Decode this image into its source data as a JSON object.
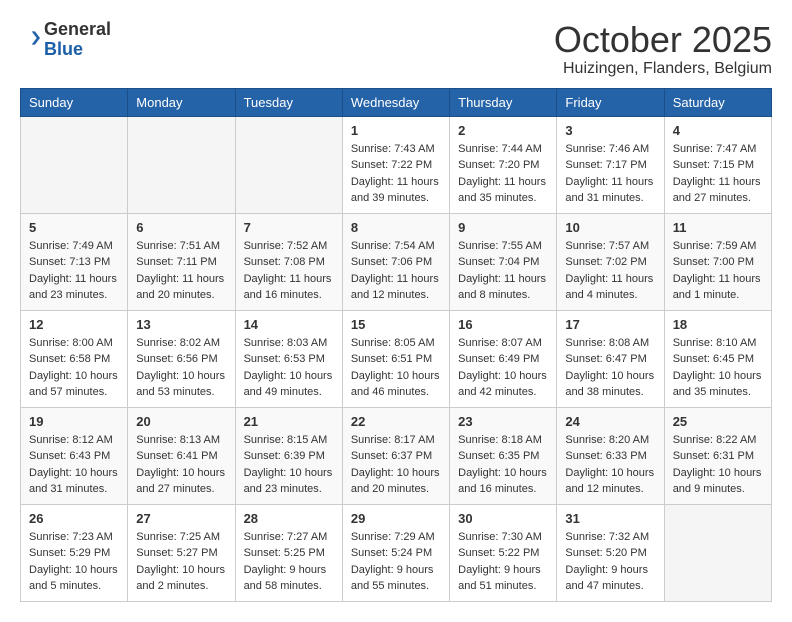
{
  "header": {
    "logo_general": "General",
    "logo_blue": "Blue",
    "month": "October 2025",
    "location": "Huizingen, Flanders, Belgium"
  },
  "weekdays": [
    "Sunday",
    "Monday",
    "Tuesday",
    "Wednesday",
    "Thursday",
    "Friday",
    "Saturday"
  ],
  "weeks": [
    [
      {
        "day": "",
        "info": ""
      },
      {
        "day": "",
        "info": ""
      },
      {
        "day": "",
        "info": ""
      },
      {
        "day": "1",
        "info": "Sunrise: 7:43 AM\nSunset: 7:22 PM\nDaylight: 11 hours\nand 39 minutes."
      },
      {
        "day": "2",
        "info": "Sunrise: 7:44 AM\nSunset: 7:20 PM\nDaylight: 11 hours\nand 35 minutes."
      },
      {
        "day": "3",
        "info": "Sunrise: 7:46 AM\nSunset: 7:17 PM\nDaylight: 11 hours\nand 31 minutes."
      },
      {
        "day": "4",
        "info": "Sunrise: 7:47 AM\nSunset: 7:15 PM\nDaylight: 11 hours\nand 27 minutes."
      }
    ],
    [
      {
        "day": "5",
        "info": "Sunrise: 7:49 AM\nSunset: 7:13 PM\nDaylight: 11 hours\nand 23 minutes."
      },
      {
        "day": "6",
        "info": "Sunrise: 7:51 AM\nSunset: 7:11 PM\nDaylight: 11 hours\nand 20 minutes."
      },
      {
        "day": "7",
        "info": "Sunrise: 7:52 AM\nSunset: 7:08 PM\nDaylight: 11 hours\nand 16 minutes."
      },
      {
        "day": "8",
        "info": "Sunrise: 7:54 AM\nSunset: 7:06 PM\nDaylight: 11 hours\nand 12 minutes."
      },
      {
        "day": "9",
        "info": "Sunrise: 7:55 AM\nSunset: 7:04 PM\nDaylight: 11 hours\nand 8 minutes."
      },
      {
        "day": "10",
        "info": "Sunrise: 7:57 AM\nSunset: 7:02 PM\nDaylight: 11 hours\nand 4 minutes."
      },
      {
        "day": "11",
        "info": "Sunrise: 7:59 AM\nSunset: 7:00 PM\nDaylight: 11 hours\nand 1 minute."
      }
    ],
    [
      {
        "day": "12",
        "info": "Sunrise: 8:00 AM\nSunset: 6:58 PM\nDaylight: 10 hours\nand 57 minutes."
      },
      {
        "day": "13",
        "info": "Sunrise: 8:02 AM\nSunset: 6:56 PM\nDaylight: 10 hours\nand 53 minutes."
      },
      {
        "day": "14",
        "info": "Sunrise: 8:03 AM\nSunset: 6:53 PM\nDaylight: 10 hours\nand 49 minutes."
      },
      {
        "day": "15",
        "info": "Sunrise: 8:05 AM\nSunset: 6:51 PM\nDaylight: 10 hours\nand 46 minutes."
      },
      {
        "day": "16",
        "info": "Sunrise: 8:07 AM\nSunset: 6:49 PM\nDaylight: 10 hours\nand 42 minutes."
      },
      {
        "day": "17",
        "info": "Sunrise: 8:08 AM\nSunset: 6:47 PM\nDaylight: 10 hours\nand 38 minutes."
      },
      {
        "day": "18",
        "info": "Sunrise: 8:10 AM\nSunset: 6:45 PM\nDaylight: 10 hours\nand 35 minutes."
      }
    ],
    [
      {
        "day": "19",
        "info": "Sunrise: 8:12 AM\nSunset: 6:43 PM\nDaylight: 10 hours\nand 31 minutes."
      },
      {
        "day": "20",
        "info": "Sunrise: 8:13 AM\nSunset: 6:41 PM\nDaylight: 10 hours\nand 27 minutes."
      },
      {
        "day": "21",
        "info": "Sunrise: 8:15 AM\nSunset: 6:39 PM\nDaylight: 10 hours\nand 23 minutes."
      },
      {
        "day": "22",
        "info": "Sunrise: 8:17 AM\nSunset: 6:37 PM\nDaylight: 10 hours\nand 20 minutes."
      },
      {
        "day": "23",
        "info": "Sunrise: 8:18 AM\nSunset: 6:35 PM\nDaylight: 10 hours\nand 16 minutes."
      },
      {
        "day": "24",
        "info": "Sunrise: 8:20 AM\nSunset: 6:33 PM\nDaylight: 10 hours\nand 12 minutes."
      },
      {
        "day": "25",
        "info": "Sunrise: 8:22 AM\nSunset: 6:31 PM\nDaylight: 10 hours\nand 9 minutes."
      }
    ],
    [
      {
        "day": "26",
        "info": "Sunrise: 7:23 AM\nSunset: 5:29 PM\nDaylight: 10 hours\nand 5 minutes."
      },
      {
        "day": "27",
        "info": "Sunrise: 7:25 AM\nSunset: 5:27 PM\nDaylight: 10 hours\nand 2 minutes."
      },
      {
        "day": "28",
        "info": "Sunrise: 7:27 AM\nSunset: 5:25 PM\nDaylight: 9 hours\nand 58 minutes."
      },
      {
        "day": "29",
        "info": "Sunrise: 7:29 AM\nSunset: 5:24 PM\nDaylight: 9 hours\nand 55 minutes."
      },
      {
        "day": "30",
        "info": "Sunrise: 7:30 AM\nSunset: 5:22 PM\nDaylight: 9 hours\nand 51 minutes."
      },
      {
        "day": "31",
        "info": "Sunrise: 7:32 AM\nSunset: 5:20 PM\nDaylight: 9 hours\nand 47 minutes."
      },
      {
        "day": "",
        "info": ""
      }
    ]
  ]
}
